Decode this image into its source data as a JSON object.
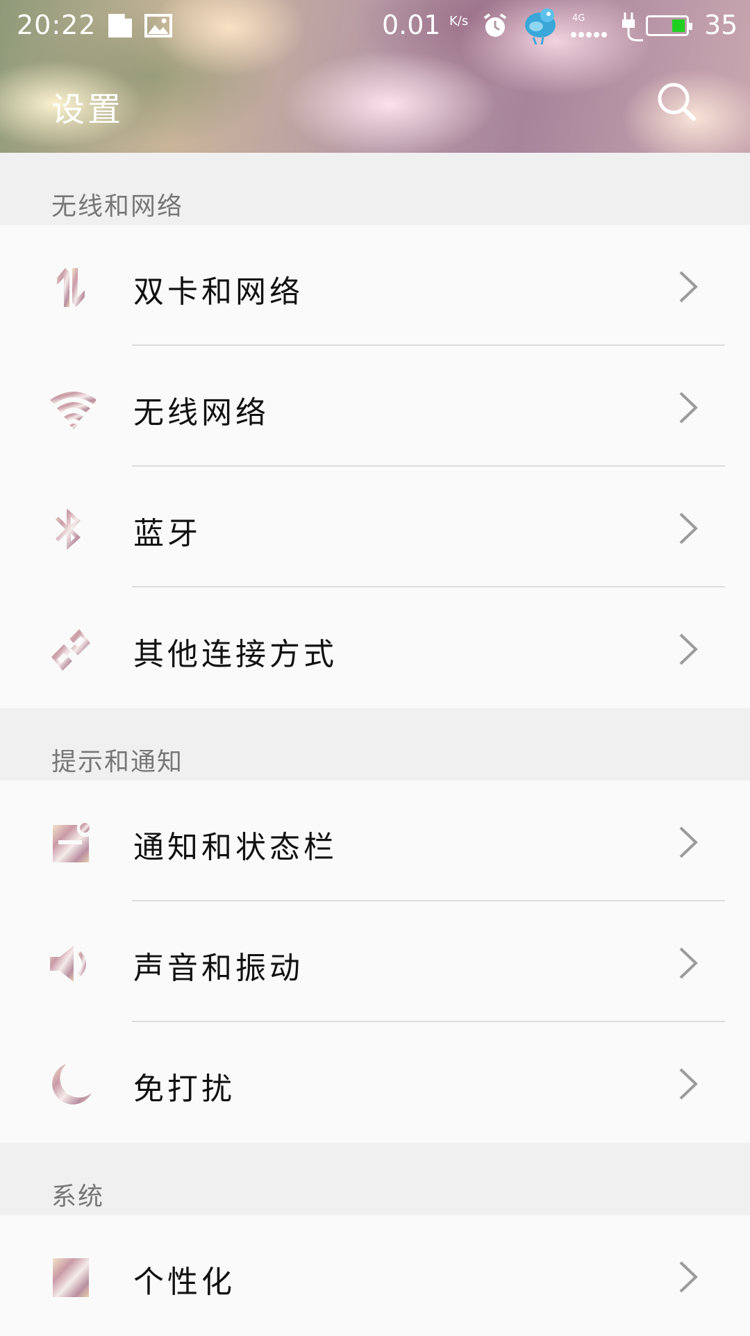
{
  "status_bar": {
    "time": "20:22",
    "net_speed": "0.01",
    "speed_unit": "K/s",
    "network_type": "4G",
    "battery_level": "35",
    "battery_color": "#20d020"
  },
  "header": {
    "title": "设置",
    "search_icon": "search-icon"
  },
  "sections": [
    {
      "title": "无线和网络",
      "items": [
        {
          "label": "双卡和网络",
          "icon": "dual-sim-icon"
        },
        {
          "label": "无线网络",
          "icon": "wifi-icon"
        },
        {
          "label": "蓝牙",
          "icon": "bluetooth-icon"
        },
        {
          "label": "其他连接方式",
          "icon": "link-icon"
        }
      ]
    },
    {
      "title": "提示和通知",
      "items": [
        {
          "label": "通知和状态栏",
          "icon": "notification-icon"
        },
        {
          "label": "声音和振动",
          "icon": "speaker-icon"
        },
        {
          "label": "免打扰",
          "icon": "moon-icon"
        }
      ]
    },
    {
      "title": "系统",
      "items": [
        {
          "label": "个性化",
          "icon": "personalize-icon"
        }
      ]
    }
  ]
}
